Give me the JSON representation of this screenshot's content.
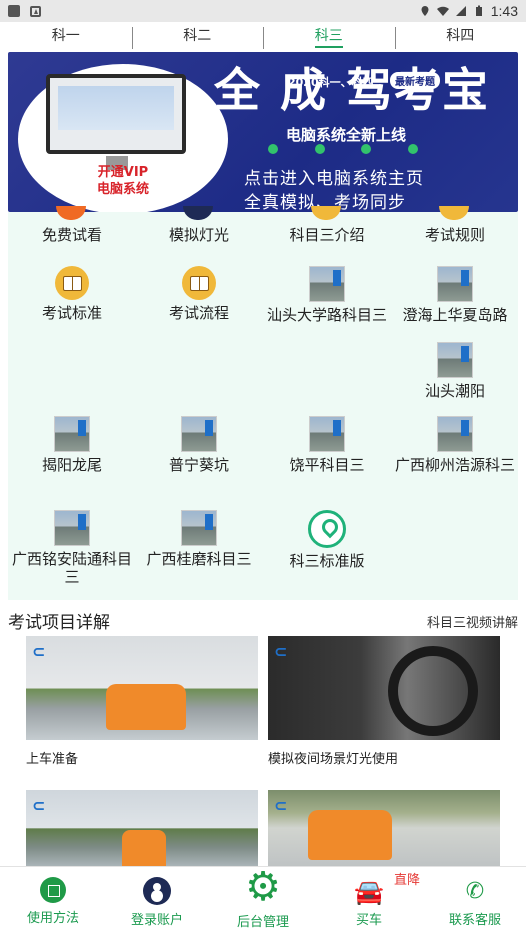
{
  "status_bar": {
    "time": "1:43"
  },
  "tabs": [
    {
      "label": "科一",
      "active": false
    },
    {
      "label": "科二",
      "active": false
    },
    {
      "label": "科三",
      "active": true
    },
    {
      "label": "科四",
      "active": false
    }
  ],
  "banner": {
    "vip_line1": "开通VIP",
    "vip_line2": "电脑系统",
    "big_title": "全 成 驾考宝",
    "year_tag": "2020科一、科四",
    "new_tag": "最新考题",
    "subtitle": "电脑系统全新上线",
    "line2": "点击进入电脑系统主页",
    "line3": "全真模拟、考场同步"
  },
  "grid": {
    "items": [
      {
        "label": "免费试看",
        "icon": "play-icon"
      },
      {
        "label": "模拟灯光",
        "icon": "light-icon"
      },
      {
        "label": "科目三介绍",
        "icon": "book-icon"
      },
      {
        "label": "考试规则",
        "icon": "book-icon"
      },
      {
        "label": "考试标准",
        "icon": "book-icon"
      },
      {
        "label": "考试流程",
        "icon": "book-icon"
      },
      {
        "label": "汕头大学路科目三",
        "icon": "road-thumbnail"
      },
      {
        "label": "澄海上华夏岛路",
        "icon": "road-thumbnail"
      },
      {
        "label": "汕头潮阳",
        "icon": "road-thumbnail"
      },
      {
        "label": "揭阳龙尾",
        "icon": "road-thumbnail"
      },
      {
        "label": "普宁葵坑",
        "icon": "road-thumbnail"
      },
      {
        "label": "饶平科目三",
        "icon": "road-thumbnail"
      },
      {
        "label": "广西柳州浩源科三",
        "icon": "road-thumbnail"
      },
      {
        "label": "广西铭安陆通科目三",
        "icon": "road-thumbnail"
      },
      {
        "label": "广西桂磨科目三",
        "icon": "road-thumbnail"
      },
      {
        "label": "科三标准版",
        "icon": "location-icon"
      }
    ]
  },
  "section": {
    "title": "考试项目详解",
    "link": "科目三视频讲解"
  },
  "videos": [
    {
      "caption": "上车准备"
    },
    {
      "caption": "模拟夜间场景灯光使用"
    },
    {
      "caption": ""
    },
    {
      "caption": ""
    }
  ],
  "bottom_nav": {
    "items": [
      {
        "label": "使用方法",
        "icon": "guide-icon"
      },
      {
        "label": "登录账户",
        "icon": "user-icon"
      },
      {
        "label": "后台管理",
        "icon": "gear-icon"
      },
      {
        "label": "买车",
        "icon": "car-icon"
      },
      {
        "label": "联系客服",
        "icon": "phone-icon"
      }
    ],
    "badge": "直降"
  },
  "colors": {
    "accent": "#20a060",
    "banner_bg": "#1d2b86",
    "grid_bg": "#eefaf5",
    "badge": "#e53935"
  }
}
